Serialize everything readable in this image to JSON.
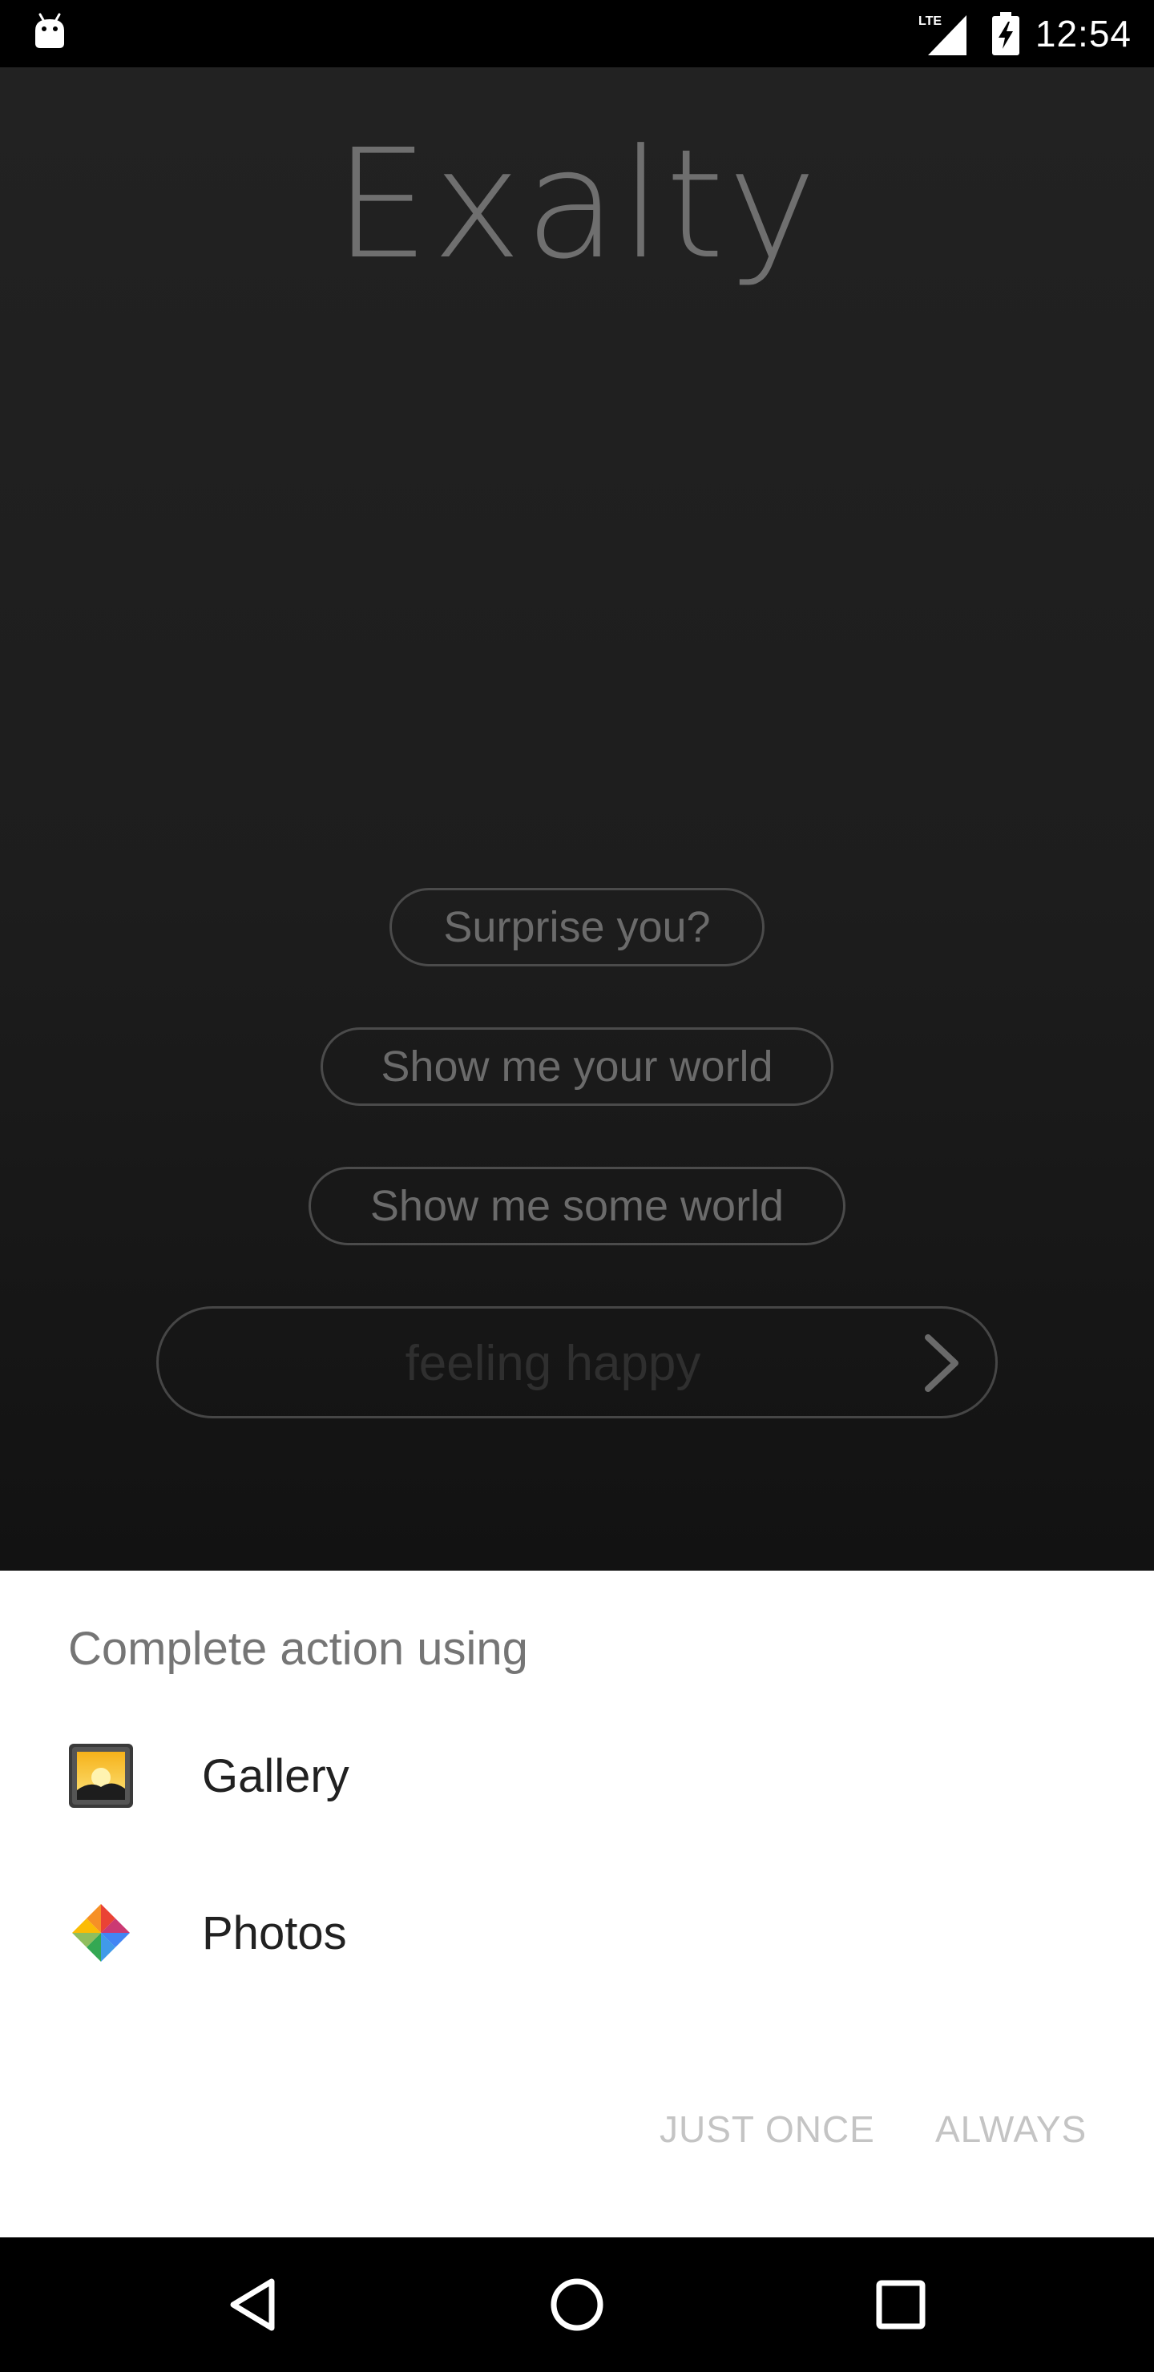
{
  "status_bar": {
    "network": "LTE",
    "time": "12:54"
  },
  "app": {
    "title": "Exalty",
    "buttons": [
      "Surprise you?",
      "Show me your world",
      "Show me some world"
    ],
    "mood_input": {
      "placeholder": "feeling happy",
      "value": ""
    }
  },
  "chooser": {
    "title": "Complete action using",
    "apps": [
      {
        "label": "Gallery",
        "icon": "gallery-icon"
      },
      {
        "label": "Photos",
        "icon": "photos-pinwheel-icon"
      }
    ],
    "just_once_label": "JUST ONCE",
    "always_label": "ALWAYS",
    "button_color": "#c4c4c4"
  },
  "nav_bar": {
    "icons": [
      "back-icon",
      "home-icon",
      "recents-icon"
    ]
  }
}
